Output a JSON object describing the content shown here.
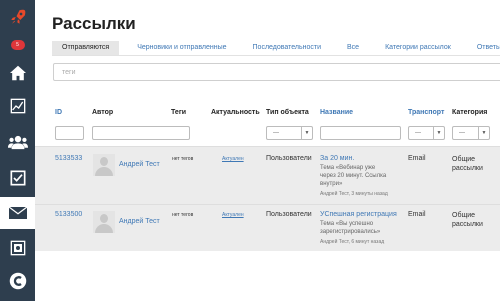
{
  "sidebar": {
    "items": [
      {
        "name": "rocket-icon"
      },
      {
        "name": "notifications-icon",
        "badge": "5"
      },
      {
        "name": "home-icon"
      },
      {
        "name": "stats-icon"
      },
      {
        "name": "users-icon"
      },
      {
        "name": "tasks-icon"
      },
      {
        "name": "mail-icon"
      },
      {
        "name": "safe-icon"
      },
      {
        "name": "logo-icon"
      }
    ]
  },
  "page_title": "Рассылки",
  "tabs": [
    {
      "label": "Отправляются"
    },
    {
      "label": "Черновики и отправленные"
    },
    {
      "label": "Последовательности"
    },
    {
      "label": "Все"
    },
    {
      "label": "Категории рассылок"
    },
    {
      "label": "Ответы"
    }
  ],
  "tags_filter": {
    "placeholder": "теги"
  },
  "table": {
    "headers": {
      "id": "ID",
      "author": "Автор",
      "tags": "Теги",
      "actuality": "Актуальность",
      "object_type": "Тип объекта",
      "name": "Название",
      "transport": "Транспорт",
      "category": "Категория"
    },
    "filters": {
      "object_type": "---",
      "transport": "---",
      "category": "---"
    },
    "rows": [
      {
        "id": "5133533",
        "author": "Андрей Тест",
        "tags": "нет тегов",
        "actuality": "Актуален",
        "object_type": "Пользователи",
        "name_title": "За 20 мин.",
        "name_line1": "Тема «Вебинар уже",
        "name_line2": "через 20 минут. Ссылка",
        "name_line3": "внутри»",
        "meta": "Андрей Тест, 3 минуты назад",
        "transport": "Email",
        "category_line1": "Общие",
        "category_line2": "рассылки"
      },
      {
        "id": "5133500",
        "author": "Андрей Тест",
        "tags": "нет тегов",
        "actuality": "Актуален",
        "object_type": "Пользователи",
        "name_title": "УСпешная регистрация",
        "name_line1": "Тема «Вы успешно",
        "name_line2": "зарегистрировались»",
        "meta": "Андрей Тест, 6 минут назад",
        "transport": "Email",
        "category_line1": "Общие",
        "category_line2": "рассылки"
      }
    ]
  },
  "colors": {
    "sidebar": "#2e3e4e",
    "link": "#3f78b5",
    "badge": "#e0363a",
    "row_bg": "#ececec"
  }
}
